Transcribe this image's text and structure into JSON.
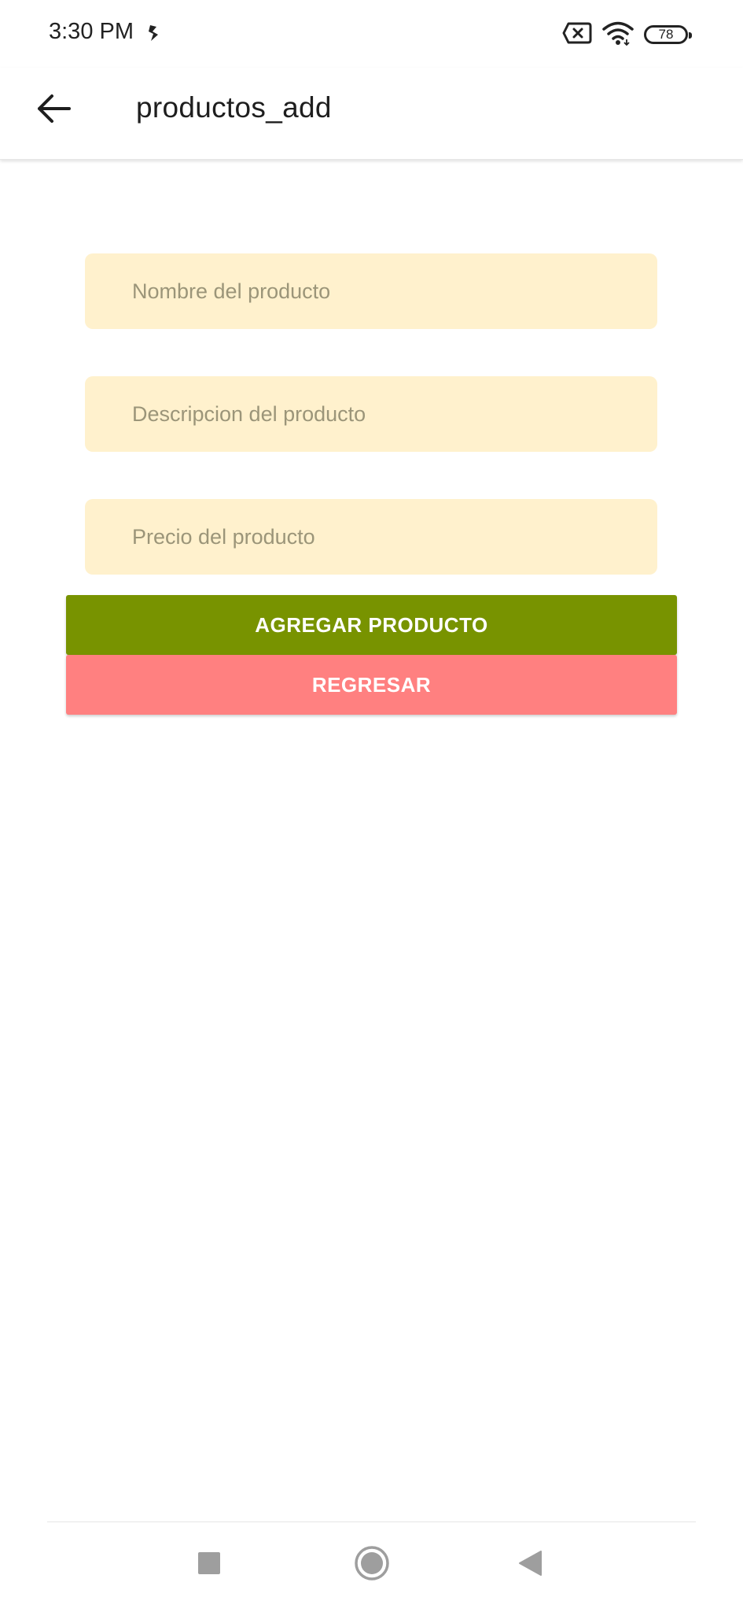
{
  "status_bar": {
    "time": "3:30 PM",
    "battery": "78",
    "icons": [
      "app-notification-icon",
      "no-sim-icon",
      "wifi-icon",
      "battery-icon"
    ]
  },
  "app_bar": {
    "title": "productos_add",
    "back_icon": "arrow-left-icon"
  },
  "form": {
    "name_placeholder": "Nombre del producto",
    "description_placeholder": "Descripcion del producto",
    "price_placeholder": "Precio del producto"
  },
  "buttons": {
    "add_label": "AGREGAR PRODUCTO",
    "back_label": "REGRESAR"
  },
  "nav_bar": {
    "icons": [
      "recent-apps-icon",
      "home-icon",
      "back-icon"
    ]
  },
  "colors": {
    "field_bg": "#fff1cd",
    "add_button": "#789300",
    "back_button": "#ff8080"
  }
}
